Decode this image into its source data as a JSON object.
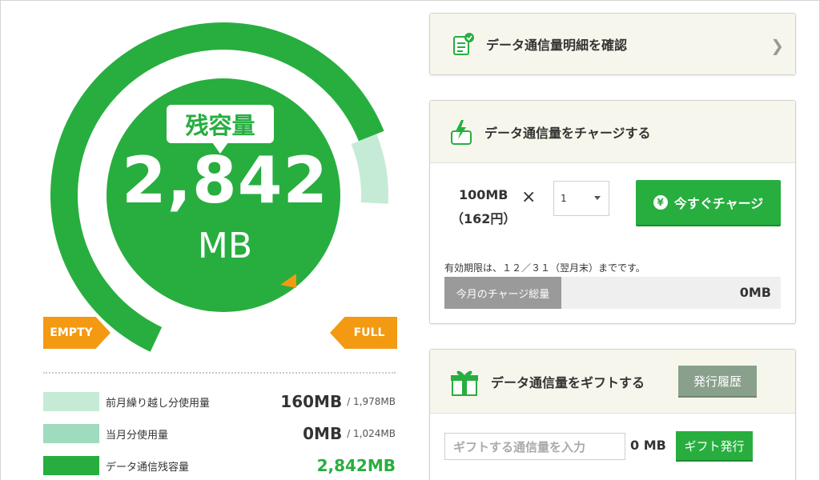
{
  "gauge": {
    "label": "残容量",
    "value": "2,842",
    "unit": "MB",
    "empty_label": "EMPTY",
    "full_label": "FULL",
    "remaining_fraction": 0.72,
    "used_fraction": 0.08
  },
  "legend": [
    {
      "label": "前月繰り越し分使用量",
      "value": "160MB",
      "total": "/ 1,978MB",
      "color": "#c5ebd6"
    },
    {
      "label": "当月分使用量",
      "value": "0MB",
      "total": "/ 1,024MB",
      "color": "#9fdbbe"
    },
    {
      "label": "データ通信残容量",
      "value": "2,842MB",
      "total": "",
      "color": "#27ae3f"
    }
  ],
  "details_card": {
    "title": "データ通信量明細を確認"
  },
  "charge_card": {
    "title": "データ通信量をチャージする",
    "amount": "100MB",
    "price": "（162円）",
    "times": "×",
    "quantity": "1",
    "button": "今すぐチャージ",
    "yen": "¥",
    "expiry": "有効期限は、１２／３１（翌月末）までです。",
    "total_label": "今月のチャージ総量",
    "total_value": "0MB"
  },
  "gift_card": {
    "title": "データ通信量をギフトする",
    "history_button": "発行履歴",
    "input_placeholder": "ギフトする通信量を入力",
    "input_unit": "0 MB",
    "issue_button": "ギフト発行"
  },
  "colors": {
    "brand_green": "#27ae3f",
    "orange": "#f39a12",
    "light_green": "#c5ebd6"
  }
}
